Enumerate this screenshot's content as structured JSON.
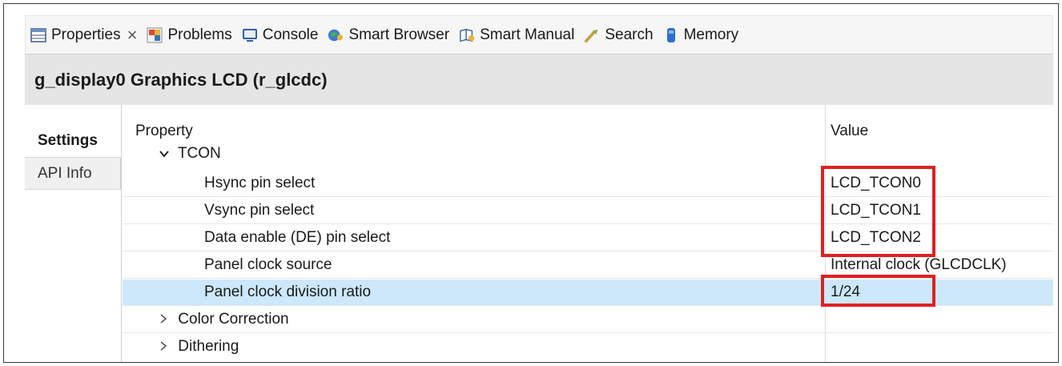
{
  "tabs": [
    {
      "label": "Properties",
      "icon": "properties-icon",
      "active": true
    },
    {
      "label": "Problems",
      "icon": "problems-icon"
    },
    {
      "label": "Console",
      "icon": "console-icon"
    },
    {
      "label": "Smart Browser",
      "icon": "smart-browser-icon"
    },
    {
      "label": "Smart Manual",
      "icon": "smart-manual-icon"
    },
    {
      "label": "Search",
      "icon": "search-icon"
    },
    {
      "label": "Memory",
      "icon": "memory-icon"
    }
  ],
  "close_glyph": "×",
  "header": {
    "title": "g_display0 Graphics LCD (r_glcdc)"
  },
  "side_tabs": [
    "Settings",
    "API Info"
  ],
  "table": {
    "col_property": "Property",
    "col_value": "Value",
    "rows": [
      {
        "label": "TCON",
        "value": "",
        "expander": "down"
      },
      {
        "label": "Hsync pin select",
        "value": "LCD_TCON0"
      },
      {
        "label": "Vsync pin select",
        "value": "LCD_TCON1"
      },
      {
        "label": "Data enable (DE) pin select",
        "value": "LCD_TCON2"
      },
      {
        "label": "Panel clock source",
        "value": "Internal clock (GLCDCLK)"
      },
      {
        "label": "Panel clock division ratio",
        "value": "1/24",
        "selected": true
      },
      {
        "label": "Color Correction",
        "value": "",
        "expander": "right"
      },
      {
        "label": "Dithering",
        "value": "",
        "expander": "right"
      }
    ]
  },
  "colors": {
    "highlight_box": "#e02020",
    "selected_row": "#cde8fb",
    "header_bg": "#e5e5e5"
  }
}
